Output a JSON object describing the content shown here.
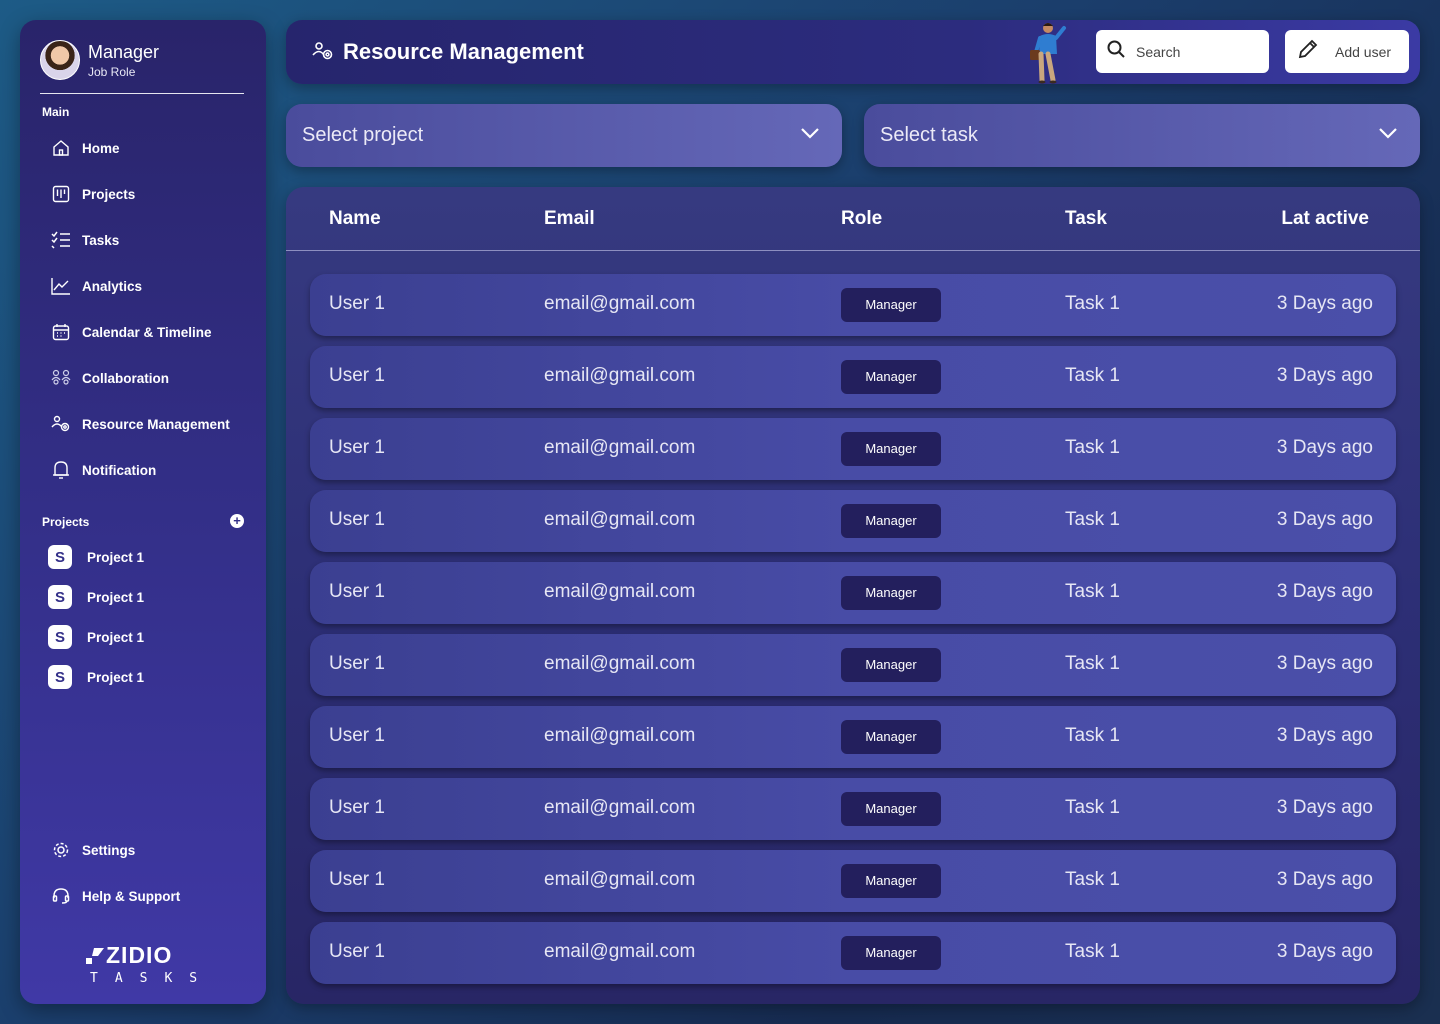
{
  "sidebar": {
    "profile": {
      "name": "Manager",
      "role": "Job Role"
    },
    "main_label": "Main",
    "nav": [
      {
        "label": "Home",
        "icon": "home-icon"
      },
      {
        "label": "Projects",
        "icon": "projects-icon"
      },
      {
        "label": "Tasks",
        "icon": "tasks-icon"
      },
      {
        "label": "Analytics",
        "icon": "analytics-icon"
      },
      {
        "label": "Calendar & Timeline",
        "icon": "calendar-icon"
      },
      {
        "label": "Collaboration",
        "icon": "collaboration-icon"
      },
      {
        "label": "Resource Management",
        "icon": "resource-icon"
      },
      {
        "label": "Notification",
        "icon": "bell-icon"
      }
    ],
    "projects_label": "Projects",
    "add_project": "+",
    "projects": [
      "Project 1",
      "Project 1",
      "Project 1",
      "Project 1"
    ],
    "project_icon_letter": "S",
    "settings": "Settings",
    "help": "Help & Support",
    "logo_main": "ZIDIO",
    "logo_sub": "TASKS"
  },
  "header": {
    "title": "Resource Management",
    "search_placeholder": "Search",
    "add_user": "Add user"
  },
  "filters": {
    "project": "Select project",
    "task": "Select task"
  },
  "table": {
    "columns": [
      "Name",
      "Email",
      "Role",
      "Task",
      "Lat active"
    ],
    "rows": [
      {
        "name": "User 1",
        "email": "email@gmail.com",
        "role": "Manager",
        "task": "Task 1",
        "last_active": "3 Days ago"
      },
      {
        "name": "User 1",
        "email": "email@gmail.com",
        "role": "Manager",
        "task": "Task 1",
        "last_active": "3 Days ago"
      },
      {
        "name": "User 1",
        "email": "email@gmail.com",
        "role": "Manager",
        "task": "Task 1",
        "last_active": "3 Days ago"
      },
      {
        "name": "User 1",
        "email": "email@gmail.com",
        "role": "Manager",
        "task": "Task 1",
        "last_active": "3 Days ago"
      },
      {
        "name": "User 1",
        "email": "email@gmail.com",
        "role": "Manager",
        "task": "Task 1",
        "last_active": "3 Days ago"
      },
      {
        "name": "User 1",
        "email": "email@gmail.com",
        "role": "Manager",
        "task": "Task 1",
        "last_active": "3 Days ago"
      },
      {
        "name": "User 1",
        "email": "email@gmail.com",
        "role": "Manager",
        "task": "Task 1",
        "last_active": "3 Days ago"
      },
      {
        "name": "User 1",
        "email": "email@gmail.com",
        "role": "Manager",
        "task": "Task 1",
        "last_active": "3 Days ago"
      },
      {
        "name": "User 1",
        "email": "email@gmail.com",
        "role": "Manager",
        "task": "Task 1",
        "last_active": "3 Days ago"
      },
      {
        "name": "User 1",
        "email": "email@gmail.com",
        "role": "Manager",
        "task": "Task 1",
        "last_active": "3 Days ago"
      }
    ]
  },
  "colors": {
    "sidebar_top": "#29246a",
    "sidebar_bottom": "#4039a6",
    "badge": "#231f5d",
    "row": "#484ca6"
  }
}
